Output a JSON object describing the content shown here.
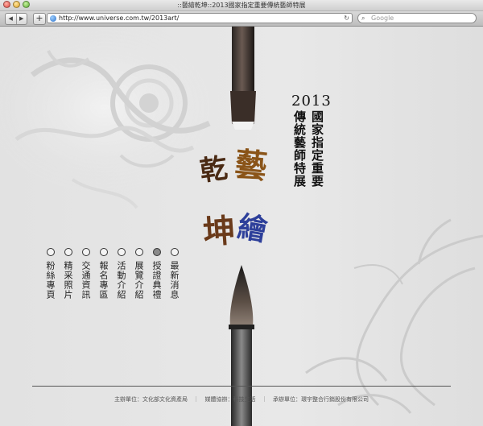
{
  "window": {
    "title": "::藝繪乾坤::2013國家指定重要傳統藝師特展"
  },
  "toolbar": {
    "back_label": "◀",
    "forward_label": "▶",
    "add_label": "+",
    "url": "http://www.universe.com.tw/2013art/",
    "reload_label": "↻",
    "search_placeholder": "Google",
    "search_icon_label": "⌕"
  },
  "page": {
    "year": "2013",
    "title_col1": "國家指定重要",
    "title_col2": "傳統藝師特展",
    "callig": {
      "qian": "乾",
      "kun": "坤",
      "yi": "藝",
      "hui": "繪"
    },
    "nav": [
      {
        "label": "粉絲專頁",
        "active": false
      },
      {
        "label": "精采照片",
        "active": false
      },
      {
        "label": "交通資訊",
        "active": false
      },
      {
        "label": "報名專區",
        "active": false
      },
      {
        "label": "活動介紹",
        "active": false
      },
      {
        "label": "展覽介紹",
        "active": false
      },
      {
        "label": "授證典禮",
        "active": true
      },
      {
        "label": "最新消息",
        "active": false
      }
    ],
    "footer": {
      "organizer": "主辦單位：文化部文化資產局",
      "separator": "｜",
      "media": "媒體協辦：科技生活",
      "contractor": "承辦單位：環宇整合行銷股份有限公司"
    }
  }
}
